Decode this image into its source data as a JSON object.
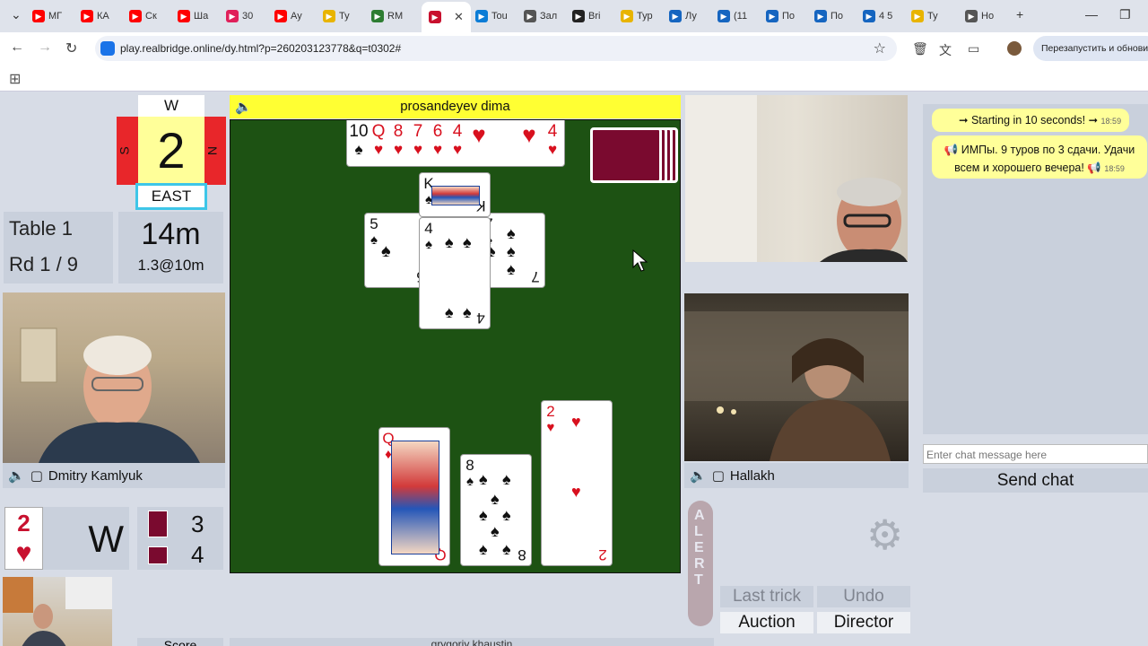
{
  "browser": {
    "tabs": [
      {
        "label": "МГ",
        "color": "#ff0000"
      },
      {
        "label": "КА",
        "color": "#ff0000"
      },
      {
        "label": "Ск",
        "color": "#ff0000"
      },
      {
        "label": "Ша",
        "color": "#ff0000"
      },
      {
        "label": "30",
        "color": "#e0205a"
      },
      {
        "label": "Ау",
        "color": "#ff0000"
      },
      {
        "label": "Ту",
        "color": "#e8b400"
      },
      {
        "label": "RM",
        "color": "#2e7d32"
      },
      {
        "label": "",
        "color": "#c8102e"
      },
      {
        "label": "Tou",
        "color": "#0a7cd6"
      },
      {
        "label": "Зал",
        "color": "#555555"
      },
      {
        "label": "Bri",
        "color": "#222222"
      },
      {
        "label": "Тур",
        "color": "#e8b400"
      },
      {
        "label": "Лу",
        "color": "#1565c0"
      },
      {
        "label": "(11",
        "color": "#1565c0"
      },
      {
        "label": "По",
        "color": "#1565c0"
      },
      {
        "label": "По",
        "color": "#1565c0"
      },
      {
        "label": "4 5",
        "color": "#1565c0"
      },
      {
        "label": "Ту",
        "color": "#e8b400"
      },
      {
        "label": "Но",
        "color": "#555555"
      }
    ],
    "url": "play.realbridge.online/dy.html?p=260203123778&q=t0302#",
    "restart_label": "Перезапустить и обновить"
  },
  "compass": {
    "top": "W",
    "left": "S",
    "right": "N",
    "board_number": "2",
    "bottom": "EAST"
  },
  "table_info": {
    "table": "Table 1",
    "round": "Rd 1 / 9",
    "time_left": "14m",
    "time_detail": "1.3@10m"
  },
  "players": {
    "north": "prosandeyev dima",
    "west": "Dmitry Kamlyuk",
    "east": "Hallakh"
  },
  "contract": {
    "level": "2",
    "suit": "♥",
    "declarer": "W",
    "tricks_ns": "3",
    "tricks_ew": "4"
  },
  "dummy": {
    "cards": [
      {
        "rank": "10",
        "suit": "♠",
        "color": "blk"
      },
      {
        "rank": "Q",
        "suit": "♥",
        "color": "red"
      },
      {
        "rank": "8",
        "suit": "♥",
        "color": "red"
      },
      {
        "rank": "7",
        "suit": "♥",
        "color": "red"
      },
      {
        "rank": "6",
        "suit": "♥",
        "color": "red"
      },
      {
        "rank": "4",
        "suit": "♥",
        "color": "red"
      },
      {
        "rank": "",
        "suit": "♥",
        "color": "red"
      },
      {
        "rank": "",
        "suit": "♥",
        "color": "red"
      },
      {
        "rank": "4",
        "suit": "♥",
        "color": "red"
      }
    ]
  },
  "trick": {
    "north": {
      "rank": "K",
      "suit": "♠",
      "color": "blk"
    },
    "west": {
      "rank": "5",
      "suit": "♠",
      "color": "blk"
    },
    "east": {
      "rank": "7",
      "suit": "♠",
      "color": "blk"
    },
    "south": {
      "rank": "4",
      "suit": "♠",
      "color": "blk"
    }
  },
  "hand": {
    "cards": [
      {
        "rank": "Q",
        "suit": "♦",
        "color": "red"
      },
      {
        "rank": "8",
        "suit": "♠",
        "color": "blk"
      },
      {
        "rank": "2",
        "suit": "♥",
        "color": "red"
      }
    ]
  },
  "chat": {
    "messages": [
      {
        "text": "➞ Starting in 10 seconds! ➞",
        "time": "18:59"
      },
      {
        "text": "📢 ИМПы. 9 туров по 3 сдачи. Удачи всем и хорошего вечера! 📢",
        "time": "18:59"
      }
    ],
    "input_placeholder": "Enter chat message here",
    "send_label": "Send chat"
  },
  "alert_letters": [
    "A",
    "L",
    "E",
    "R",
    "T"
  ],
  "controls": {
    "last_trick": "Last trick",
    "undo": "Undo",
    "auction": "Auction",
    "director": "Director"
  },
  "bottom": {
    "score": "Score",
    "partner_name": "grygoriy khaustin"
  }
}
